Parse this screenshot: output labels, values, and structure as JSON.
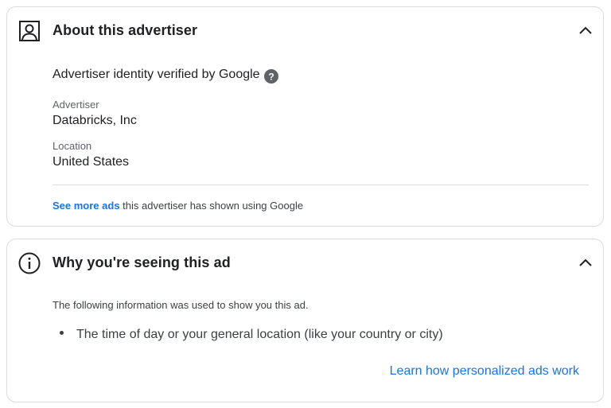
{
  "advertiser_card": {
    "title": "About this advertiser",
    "header_icon": "person-icon",
    "collapse_icon": "chevron-up-icon",
    "verified_text": "Advertiser identity verified by Google",
    "help_icon": "help-circle-icon",
    "advertiser_label": "Advertiser",
    "advertiser_value": "Databricks, Inc",
    "location_label": "Location",
    "location_value": "United States",
    "see_more_link": "See more ads",
    "see_more_suffix": " this advertiser has shown using Google"
  },
  "why_card": {
    "title": "Why you're seeing this ad",
    "header_icon": "info-icon",
    "collapse_icon": "chevron-up-icon",
    "intro": "The following information was used to show you this ad.",
    "reasons": [
      "The time of day or your general location (like your country or city)"
    ],
    "learn_link": "Learn how personalized ads work"
  },
  "colors": {
    "link": "#1a73e8",
    "border": "#dadce0",
    "text_primary": "#202124",
    "text_secondary": "#5f6368"
  }
}
